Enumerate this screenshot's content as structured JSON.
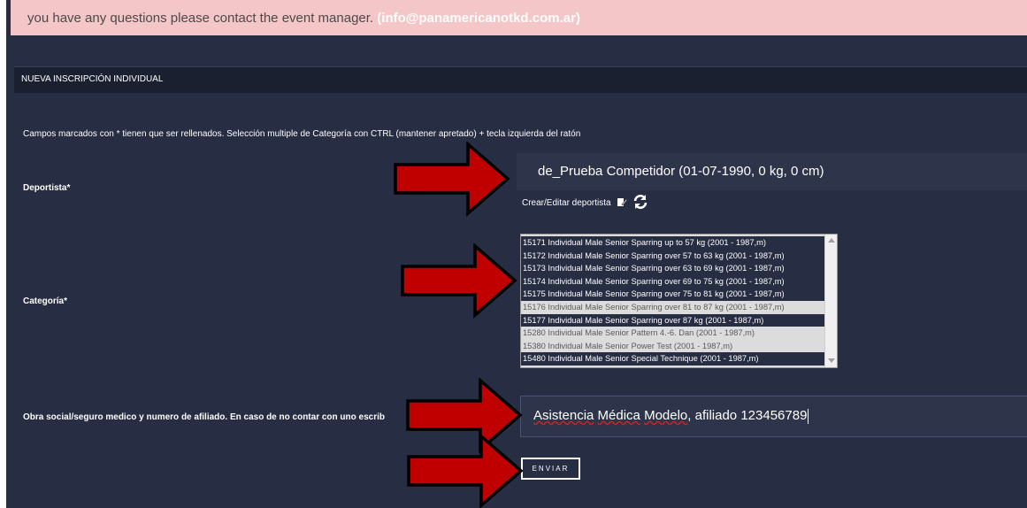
{
  "alert": {
    "line1": "",
    "line2": "you have any questions please contact the event manager.",
    "email": "(info@panamericanotkd.com.ar)"
  },
  "form": {
    "header": "NUEVA INSCRIPCIÓN INDIVIDUAL",
    "instructions": "Campos marcados con * tienen que ser rellenados. Selección multiple de Categoría con CTRL (mantener apretado) + tecla izquierda del ratón",
    "athlete": {
      "label": "Deportista*",
      "value": "de_Prueba Competidor (01-07-1990, 0 kg, 0 cm)",
      "create_link": "Crear/Editar deportista",
      "edit_icon": "edit-icon",
      "refresh_icon": "refresh-icon"
    },
    "category": {
      "label": "Categoría*",
      "options": [
        {
          "text": "15171 Individual Male Senior Sparring up to 57 kg (2001 - 1987,m)",
          "selected": true
        },
        {
          "text": "15172 Individual Male Senior Sparring over 57 to 63 kg (2001 - 1987,m)",
          "selected": true
        },
        {
          "text": "15173 Individual Male Senior Sparring over 63 to 69 kg (2001 - 1987,m)",
          "selected": true
        },
        {
          "text": "15174 Individual Male Senior Sparring over 69 to 75 kg (2001 - 1987,m)",
          "selected": true
        },
        {
          "text": "15175 Individual Male Senior Sparring over 75 to 81 kg (2001 - 1987,m)",
          "selected": true
        },
        {
          "text": "15176 Individual Male Senior Sparring over 81 to 87 kg (2001 - 1987,m)",
          "selected": false
        },
        {
          "text": "15177 Individual Male Senior Sparring over 87 kg (2001 - 1987,m)",
          "selected": true
        },
        {
          "text": "15280 Individual Male Senior Pattern 4.-6. Dan (2001 - 1987,m)",
          "selected": false
        },
        {
          "text": "15380 Individual Male Senior Power Test (2001 - 1987,m)",
          "selected": false
        },
        {
          "text": "15480 Individual Male Senior Special Technique (2001 - 1987,m)",
          "selected": true
        }
      ]
    },
    "insurance": {
      "label": "Obra social/seguro medico y numero de afiliado. En caso de no contar con uno escrib",
      "value_part1": "Asistencia",
      "value_part2": "Médica",
      "value_part3": "Modelo",
      "value_part4": ", afiliado",
      "value_part5": "123456789"
    },
    "submit_label": "ENVIAR"
  },
  "colors": {
    "panel": "#272d42",
    "alert_bg": "#f4c6c7",
    "arrow": "#c00000"
  }
}
